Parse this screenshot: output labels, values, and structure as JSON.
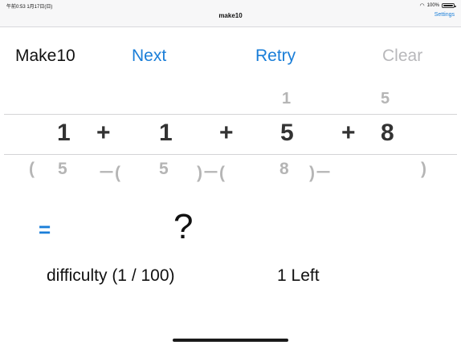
{
  "status_bar": {
    "time": "午前0:53  1月17日(日)",
    "battery_text": "100%"
  },
  "nav": {
    "title": "make10",
    "settings_label": "Settings"
  },
  "controls": {
    "app_name": "Make10",
    "next_label": "Next",
    "retry_label": "Retry",
    "clear_label": "Clear"
  },
  "picker": {
    "faded_top": [
      "1",
      "5"
    ],
    "selected": {
      "n1": "1",
      "op1": "+",
      "n2": "1",
      "op2": "+",
      "n3": "5",
      "op3": "+",
      "n4": "8"
    },
    "faded_bottom": [
      "(",
      "5",
      "－(",
      "5",
      ")－(",
      "8",
      ")－",
      ")"
    ]
  },
  "result": {
    "equals": "=",
    "answer": "?"
  },
  "footer": {
    "difficulty": "difficulty (1 / 100)",
    "left": "1 Left"
  }
}
